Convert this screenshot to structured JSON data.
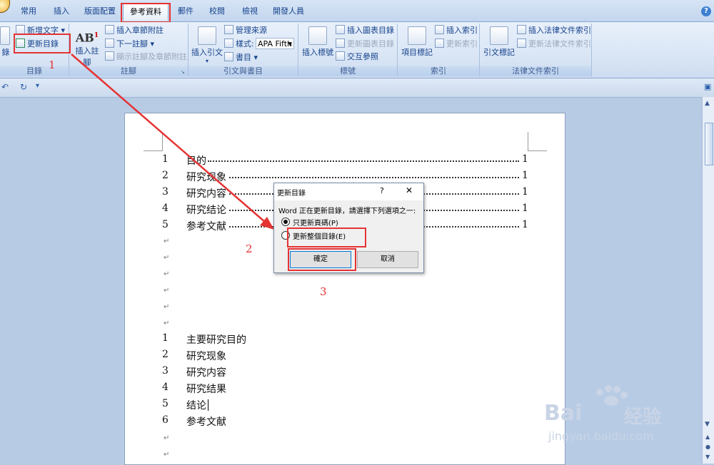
{
  "tabs": [
    "常用",
    "插入",
    "版面配置",
    "參考資料",
    "郵件",
    "校閱",
    "檢視",
    "開發人員"
  ],
  "active_tab": "參考資料",
  "ribbon": {
    "toc_group": {
      "big_label": "錄",
      "add_text": "新增文字",
      "update_toc": "更新目錄",
      "title": "目錄"
    },
    "footnotes": {
      "insert_footnote": "插入註腳",
      "insert_endnote": "插入章節附註",
      "next_footnote": "下一註腳",
      "show_notes": "顯示註腳及章節附註",
      "title": "註腳"
    },
    "citations": {
      "insert_citation": "插入引文",
      "manage_sources": "管理來源",
      "style_label": "樣式:",
      "style_value": "APA Fifth",
      "bibliography": "書目",
      "title": "引文與書目"
    },
    "captions": {
      "insert_caption": "插入標號",
      "insert_figures_table": "插入圖表目錄",
      "update_table": "更新圖表目錄",
      "cross_reference": "交互參照",
      "title": "標號"
    },
    "index": {
      "mark_entry": "項目標記",
      "insert_index": "插入索引",
      "update_index": "更新索引",
      "title": "索引"
    },
    "authorities": {
      "mark_citation": "引文標記",
      "insert_table": "插入法律文件索引",
      "update_table": "更新法律文件索引",
      "title": "法律文件索引"
    }
  },
  "toc_entries": [
    {
      "num": "1",
      "text": "目的",
      "page": "1"
    },
    {
      "num": "2",
      "text": "研究现象",
      "page": "1"
    },
    {
      "num": "3",
      "text": "研究内容",
      "page": "1"
    },
    {
      "num": "4",
      "text": "研究结论",
      "page": "1"
    },
    {
      "num": "5",
      "text": "参考文献",
      "page": "1"
    }
  ],
  "body_headings": [
    {
      "num": "1",
      "text": "主要研究目的"
    },
    {
      "num": "2",
      "text": "研究现象"
    },
    {
      "num": "3",
      "text": "研究内容"
    },
    {
      "num": "4",
      "text": "研究结果"
    },
    {
      "num": "5",
      "text": "结论"
    },
    {
      "num": "6",
      "text": "参考文献"
    }
  ],
  "para_mark": "↵",
  "dialog": {
    "title": "更新目錄",
    "help": "?",
    "close": "✕",
    "prompt": "Word 正在更新目錄，請選擇下列選項之一:",
    "option1": "只更新頁碼(P)",
    "option2": "更新整個目錄(E)",
    "ok": "確定",
    "cancel": "取消"
  },
  "callouts": {
    "c1": "1",
    "c2": "2",
    "c3": "3"
  },
  "watermark": {
    "brand": "Bai",
    "brand2": "经验",
    "url": "jingyan.baidu.com"
  }
}
